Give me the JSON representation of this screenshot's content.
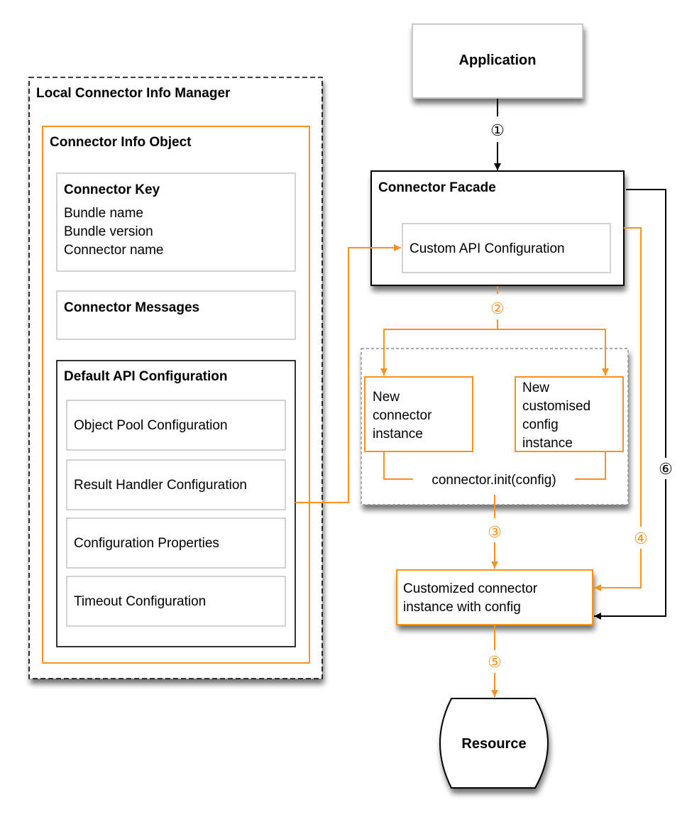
{
  "colors": {
    "accent": "#f7931e",
    "black": "#000000",
    "gray_border": "#c8c8c8",
    "dashed_gray": "#8a8f96"
  },
  "application": {
    "label": "Application"
  },
  "manager": {
    "title": "Local Connector Info Manager",
    "info_object": {
      "title": "Connector Info Object",
      "connector_key": {
        "title": "Connector Key",
        "lines": [
          "Bundle name",
          "Bundle version",
          "Connector name"
        ]
      },
      "connector_messages": {
        "title": "Connector Messages"
      },
      "default_api_config": {
        "title": "Default API Configuration",
        "items": [
          "Object Pool Configuration",
          "Result Handler Configuration",
          "Configuration Properties",
          "Timeout Configuration"
        ]
      }
    }
  },
  "facade": {
    "title": "Connector Facade",
    "custom_api_config": "Custom API Configuration"
  },
  "instances": {
    "connector": [
      "New",
      "connector",
      "instance"
    ],
    "config": [
      "New",
      "customised",
      "config",
      "instance"
    ],
    "init_call": "connector.init(config)"
  },
  "customized": {
    "lines": [
      "Customized connector",
      "instance with config"
    ]
  },
  "resource": {
    "label": "Resource"
  },
  "steps": [
    "①",
    "②",
    "③",
    "④",
    "⑤",
    "⑥"
  ]
}
